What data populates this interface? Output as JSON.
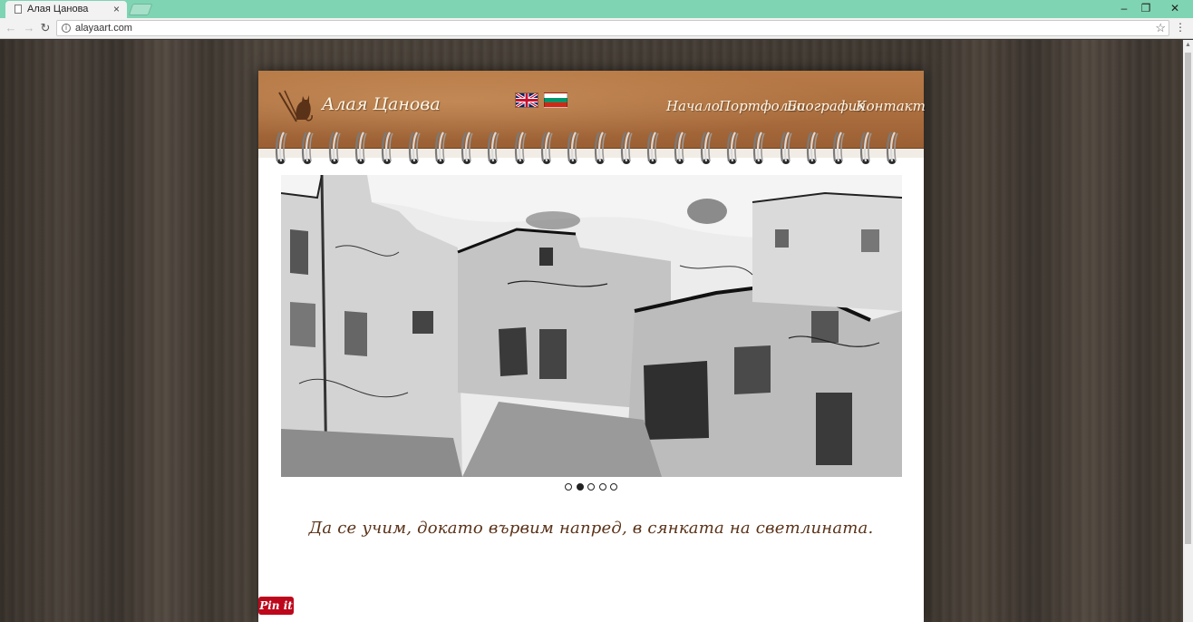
{
  "browser": {
    "tab_title": "Алая Цанова",
    "tab_close": "×",
    "url": "alayaart.com",
    "controls": {
      "minimize": "–",
      "maximize": "❐",
      "close": "✕"
    },
    "nav": {
      "back": "←",
      "forward": "→",
      "reload": "↻"
    },
    "star": "☆",
    "menu": "⋮"
  },
  "site": {
    "title": "Алая Цанова",
    "nav": [
      "Начало",
      "Портфолио",
      "Биография",
      "Контакт"
    ],
    "languages": [
      "English",
      "Български"
    ],
    "quote": "Да се учим, докато вървим напред, в сянката на светлината.",
    "pin_label": "Pin it"
  },
  "slider": {
    "slide_count": 5,
    "active_slide": 2
  },
  "colors": {
    "cover": "#a96c3d",
    "quote": "#5a3218",
    "pinterest": "#bd081c",
    "titlebar": "#7fd4b3"
  },
  "icons": [
    "page-icon",
    "info-icon",
    "star-icon",
    "menu-icon",
    "cat-logo-icon",
    "uk-flag-icon",
    "bg-flag-icon"
  ]
}
